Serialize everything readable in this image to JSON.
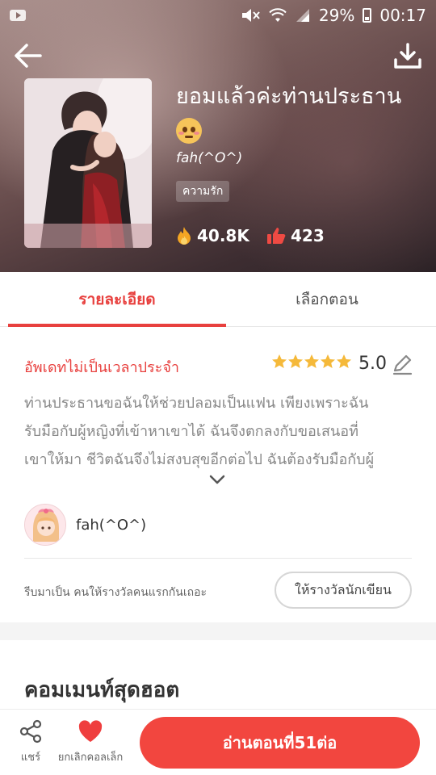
{
  "status_bar": {
    "battery": "29%",
    "time": "00:17",
    "icons": [
      "video-icon",
      "mute-icon",
      "wifi-icon",
      "signal-icon",
      "battery-icon"
    ]
  },
  "header": {
    "back_icon": "arrow-left-icon",
    "download_icon": "download-icon"
  },
  "book": {
    "title": "ยอมแล้วค่ะท่านประธาน",
    "title_emoji": "pleading-face-emoji",
    "author": "fah(^O^)",
    "tag": "ความรัก",
    "views": "40.8K",
    "likes": "423",
    "views_icon": "fire-icon",
    "likes_icon": "thumbs-up-icon"
  },
  "tabs": [
    {
      "label": "รายละเอียด",
      "active": true
    },
    {
      "label": "เลือกตอน",
      "active": false
    }
  ],
  "details": {
    "update_status": "อัพเดทไม่เป็นเวลาประจำ",
    "rating_value": "5.0",
    "stars": 5,
    "description_lines": [
      "ท่านประธานขอฉันให้ช่วยปลอมเป็นแฟน เพียงเพราะฉัน",
      "รับมือกับผู้หญิงที่เข้าหาเขาได้ ฉันจึงตกลงกับขอเสนอที่",
      "เขาให้มา ชีวิตฉันจึงไม่สงบสุขอีกต่อไป ฉันต้องรับมือกับผู้"
    ],
    "author_name": "fah(^O^)",
    "reward_prompt": "รีบมาเป็น คนให้รางวัลคนแรกกันเถอะ",
    "reward_button": "ให้รางวัลนักเขียน"
  },
  "comments": {
    "title": "คอมเมนท์สุดฮอต"
  },
  "bottom_bar": {
    "share_label": "แชร์",
    "favorite_label": "ยกเลิกคอลเล็ก",
    "read_button": "อ่านตอนที่51ต่อ"
  },
  "colors": {
    "accent": "#e8403e",
    "read_button": "#f2463f",
    "star": "#f5b93a"
  }
}
